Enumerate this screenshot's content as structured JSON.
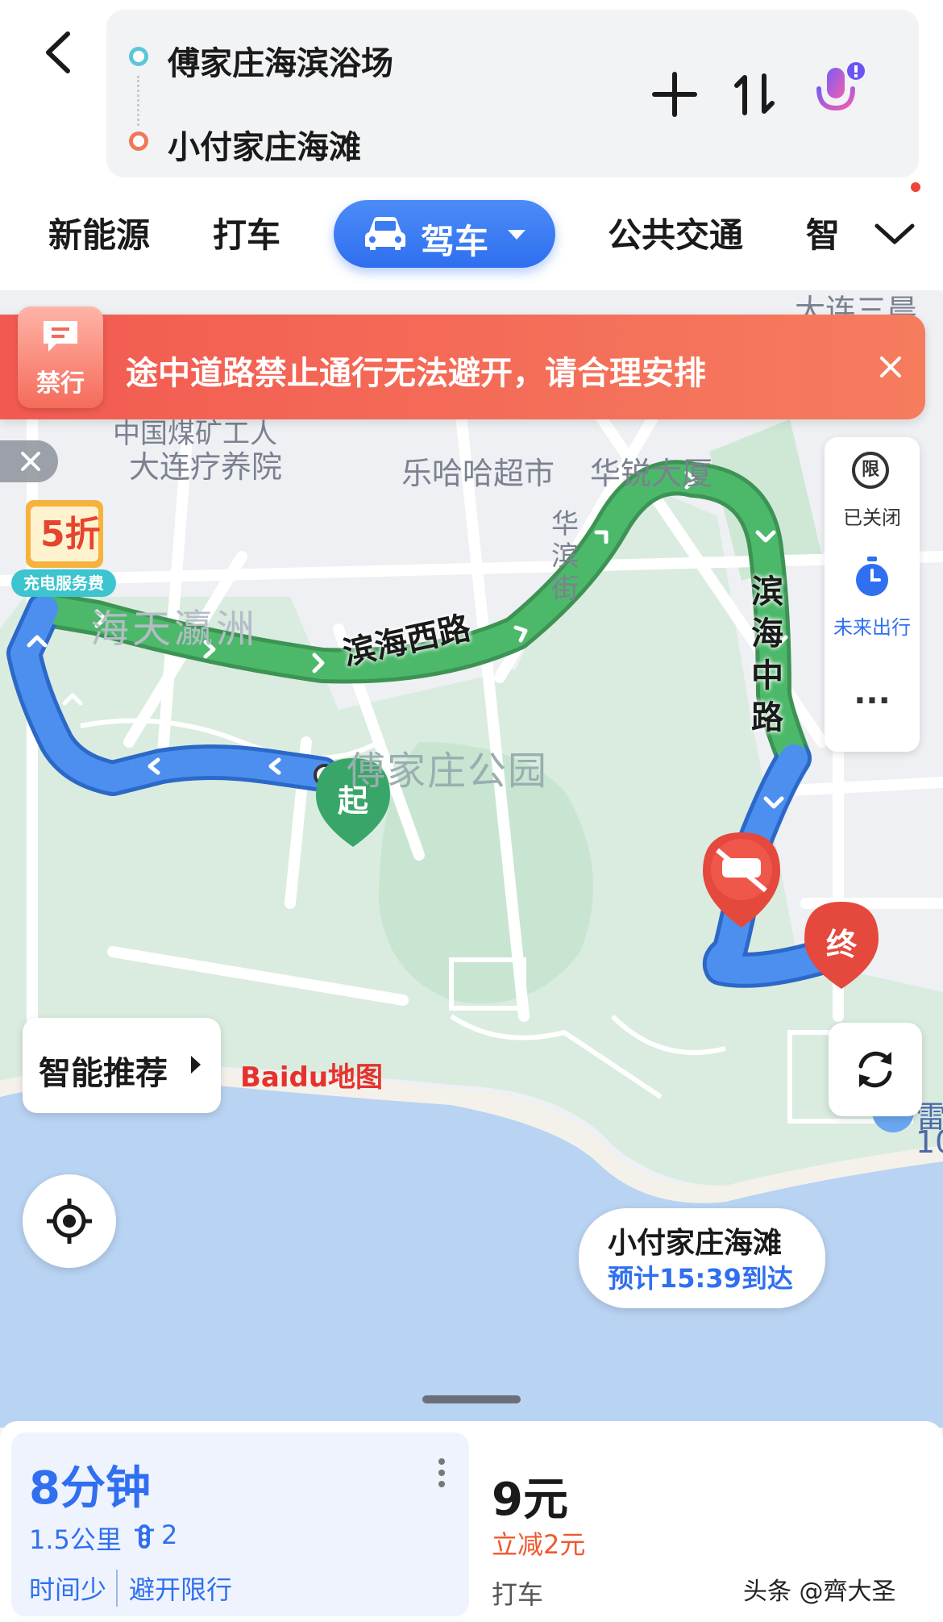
{
  "header": {
    "start_location": "傅家庄海滨浴场",
    "end_location": "小付家庄海滩",
    "icons": [
      "back-arrow-icon",
      "plus-icon",
      "swap-icon",
      "microphone-icon"
    ]
  },
  "tabs": [
    {
      "label": "新能源"
    },
    {
      "label": "打车"
    },
    {
      "label": "驾车",
      "active": true
    },
    {
      "label": "公共交通"
    },
    {
      "label": "智"
    }
  ],
  "map": {
    "alert": {
      "badge": "禁行",
      "text": "途中道路禁止通行无法避开，请合理安排"
    },
    "labels": {
      "poi1_line1": "中国煤矿工人",
      "poi1_line2": "大连疗养院",
      "poi2": "乐哈哈超市",
      "poi3": "华锐大厦",
      "poi4": "大连三晨",
      "area1": "海天瀛洲",
      "street_v": "华滨街",
      "park": "傅家庄公园",
      "road1": "滨海西路",
      "road2": "滨海中路",
      "poi_right": "雷",
      "poi_right2": "10"
    },
    "charge_promo": {
      "discount": "5折",
      "label": "充电服务费"
    },
    "side_panel": {
      "restriction": "已关闭",
      "restriction_icon": "限",
      "future": "未来出行",
      "more": "···"
    },
    "start_marker": "起",
    "end_marker": "终",
    "destination": {
      "name": "小付家庄海滩",
      "eta": "预计15:39到达"
    },
    "smart_recommend": "智能推荐",
    "logo": "Baidu地图"
  },
  "route_card": {
    "time": "8分钟",
    "distance": "1.5公里",
    "traffic_lights": "2",
    "tags": [
      "时间少",
      "避开限行"
    ]
  },
  "taxi_card": {
    "price": "9元",
    "discount": "立减2元",
    "label": "打车"
  },
  "watermark": "头条 @齊大圣",
  "colors": {
    "primary": "#2f6ff0",
    "route_green": "#4cb86a",
    "route_blue": "#4d8fef",
    "alert": "#f25a51"
  }
}
